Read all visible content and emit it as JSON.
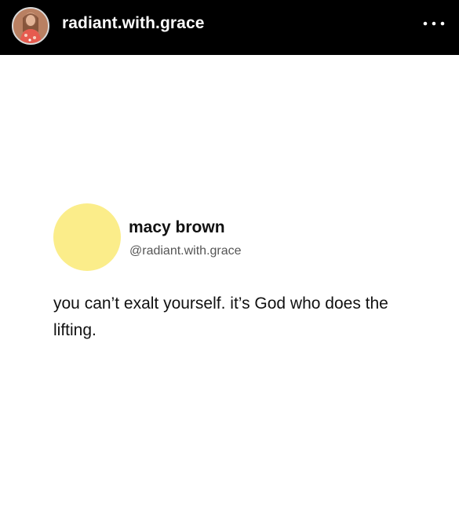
{
  "header": {
    "username": "radiant.with.grace",
    "avatar_icon": "profile-photo-icon",
    "more_icon": "more-options-icon",
    "background": "#000000",
    "text_color": "#ffffff"
  },
  "post": {
    "author_name": "macy brown",
    "author_handle": "@radiant.with.grace",
    "avatar_color": "#fbed8a",
    "text": "you can’t exalt yourself. it’s God who does the lifting."
  }
}
